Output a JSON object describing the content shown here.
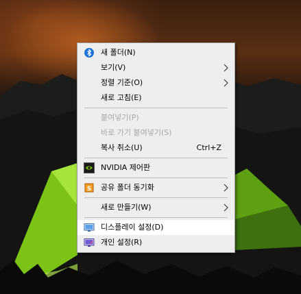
{
  "context_menu": {
    "items": [
      {
        "label": "새 폴더(N)",
        "icon": "bluetooth-icon"
      },
      {
        "label": "보기(V)",
        "submenu": true
      },
      {
        "label": "정렬 기준(O)",
        "submenu": true
      },
      {
        "label": "새로 고침(E)"
      },
      {
        "label": "붙여넣기(P)",
        "disabled": true
      },
      {
        "label": "바로 가기 붙여넣기(S)",
        "disabled": true
      },
      {
        "label": "복사 취소(U)",
        "shortcut": "Ctrl+Z"
      },
      {
        "label": "NVIDIA 제어판",
        "icon": "nvidia-icon"
      },
      {
        "label": "공유 폴더 동기화",
        "icon": "sync-folder-icon",
        "submenu": true
      },
      {
        "label": "새로 만들기(W)",
        "submenu": true
      },
      {
        "label": "디스플레이 설정(D)",
        "icon": "display-icon",
        "highlighted": true
      },
      {
        "label": "개인 설정(R)",
        "icon": "personalize-icon"
      }
    ]
  },
  "colors": {
    "menu_background": "#eeeeee",
    "highlight": "#ffffff",
    "disabled_text": "#a6a6a6",
    "separator": "#bdbdbd"
  }
}
